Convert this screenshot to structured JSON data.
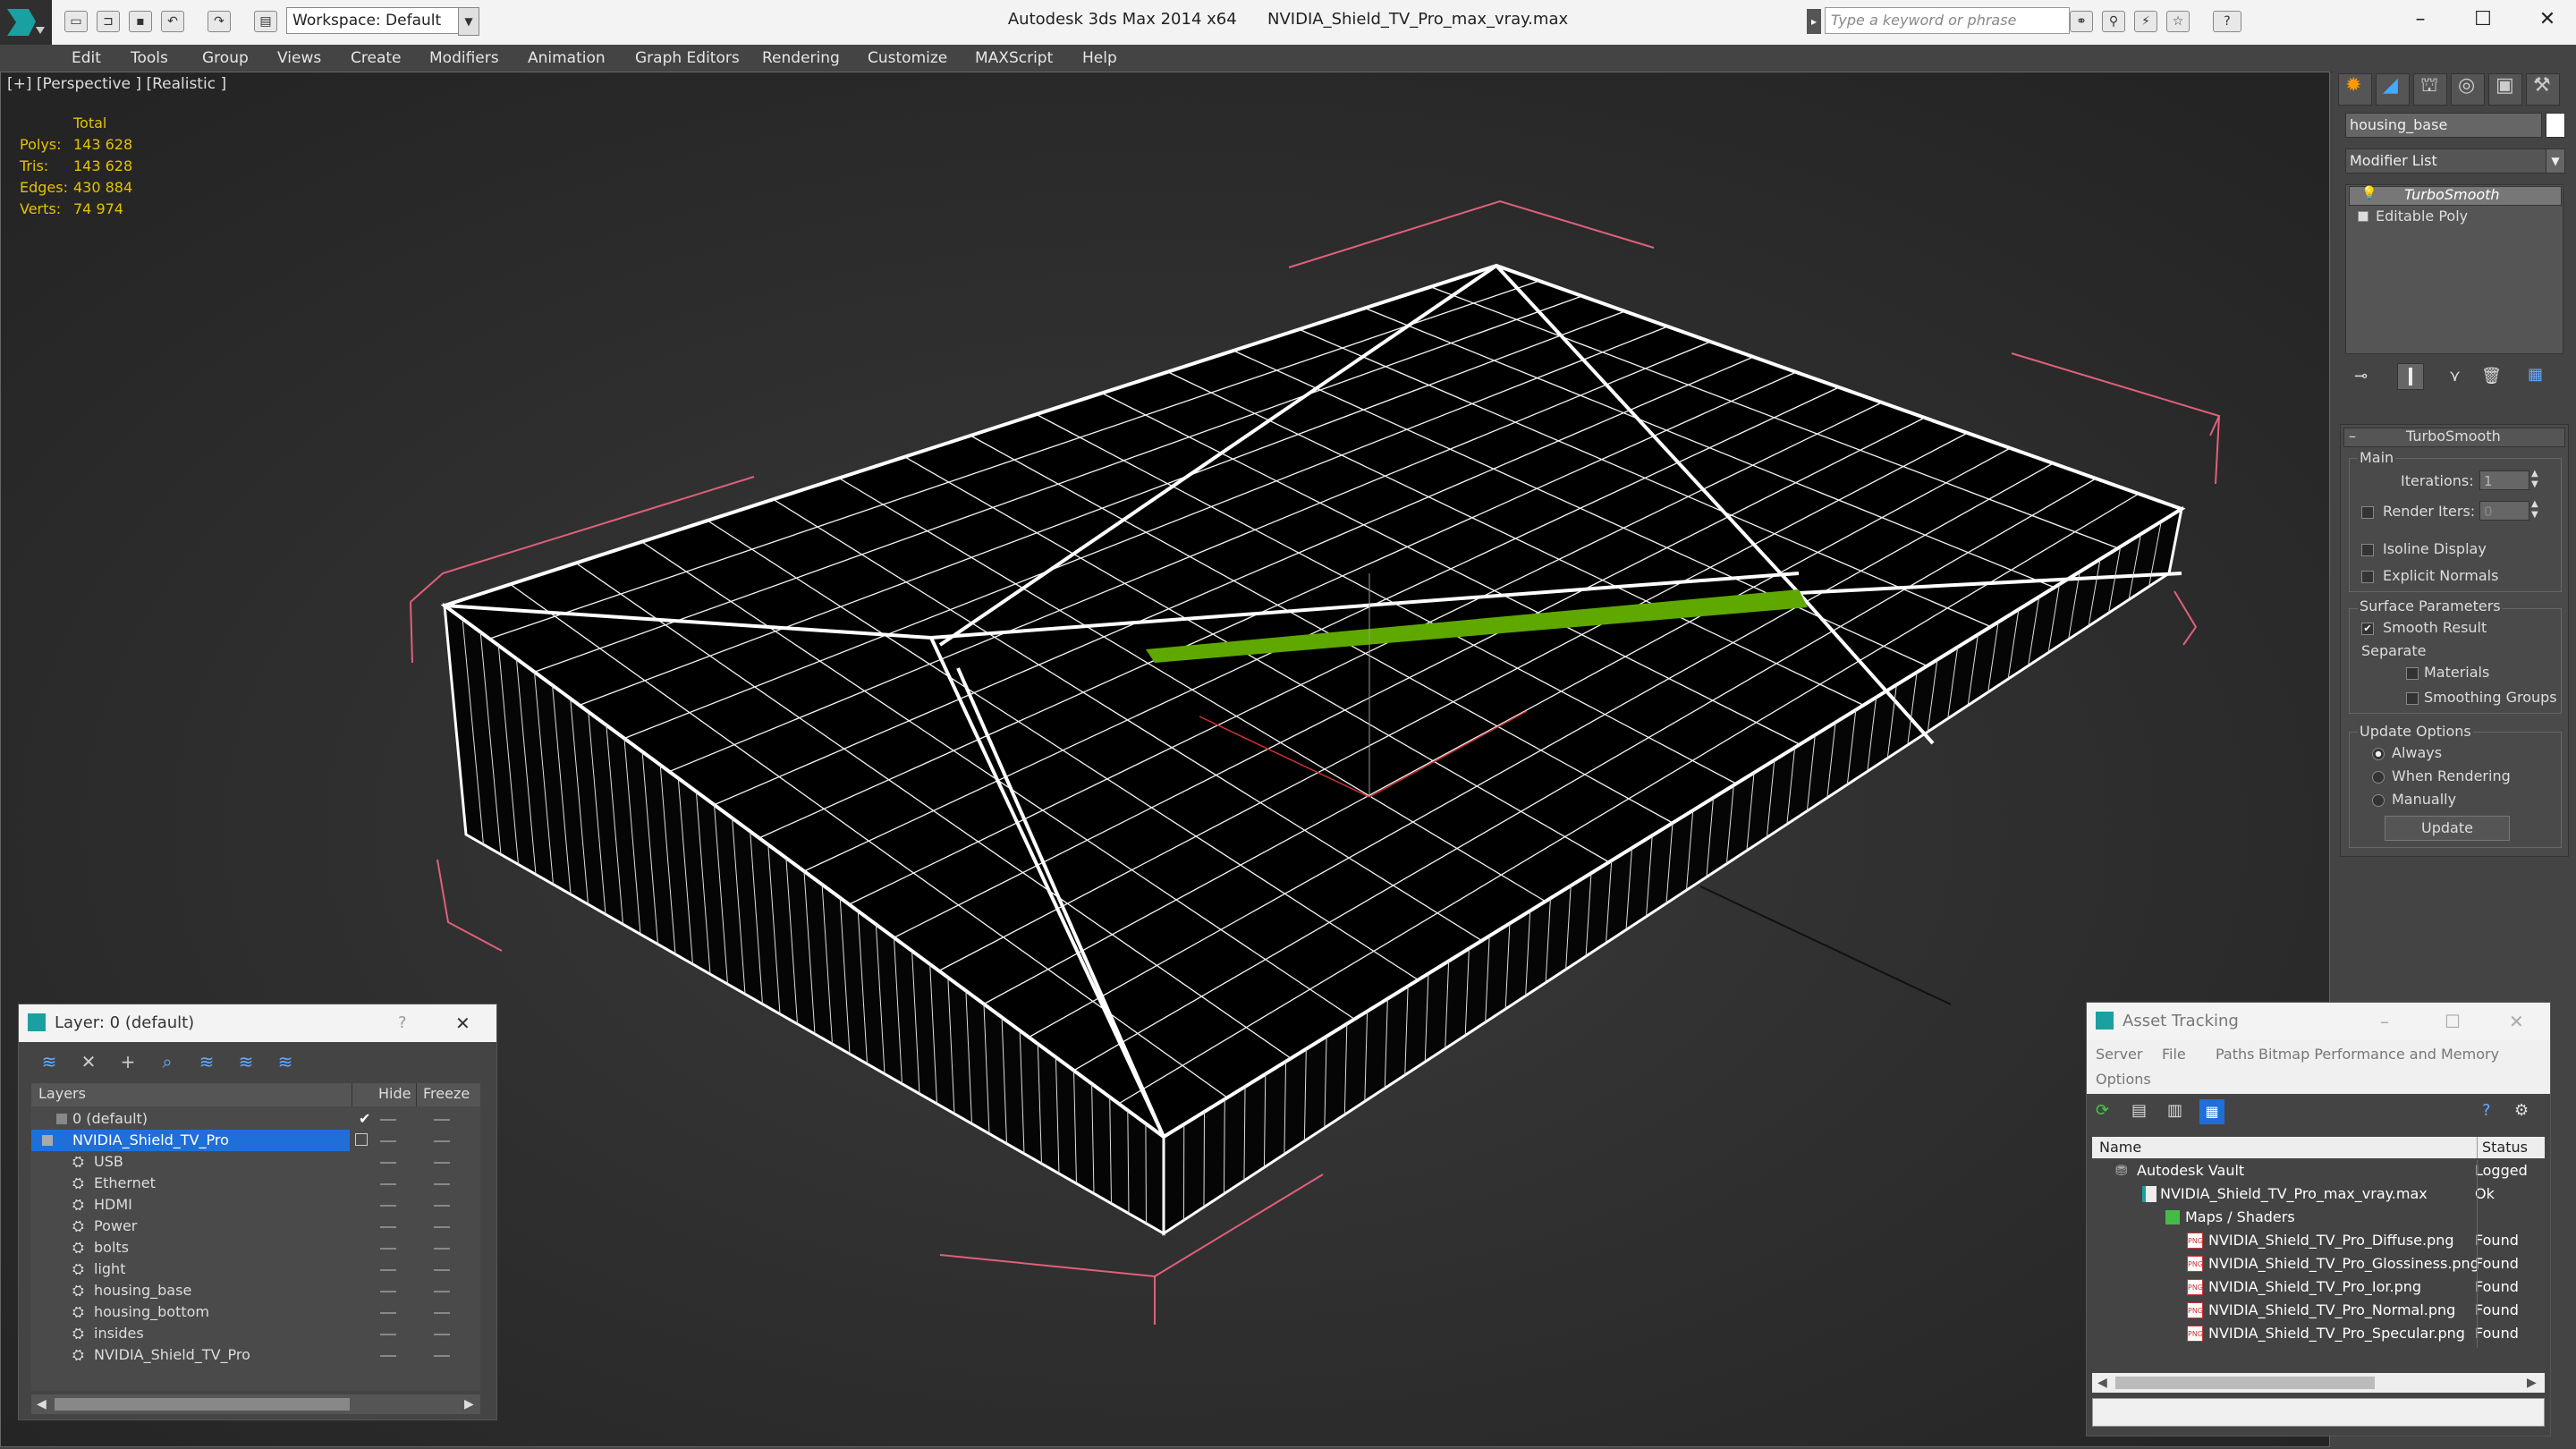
{
  "titlebar": {
    "app": "Autodesk 3ds Max  2014 x64",
    "file": "NVIDIA_Shield_TV_Pro_max_vray.max",
    "workspace": "Workspace: Default",
    "search_placeholder": "Type a keyword or phrase"
  },
  "menu": [
    "Edit",
    "Tools",
    "Group",
    "Views",
    "Create",
    "Modifiers",
    "Animation",
    "Graph Editors",
    "Rendering",
    "Customize",
    "MAXScript",
    "Help"
  ],
  "viewport": {
    "label": "[+] [Perspective ] [Realistic ]",
    "stats_header": "Total",
    "stats": [
      {
        "label": "Polys:",
        "value": "143 628"
      },
      {
        "label": "Tris:",
        "value": "143 628"
      },
      {
        "label": "Edges:",
        "value": "430 884"
      },
      {
        "label": "Verts:",
        "value": "74 974"
      }
    ]
  },
  "command_panel": {
    "object_name": "housing_base",
    "modifier_list": "Modifier List",
    "stack": [
      "TurboSmooth",
      "Editable Poly"
    ],
    "rollout_title": "TurboSmooth",
    "main_label": "Main",
    "iterations_label": "Iterations:",
    "iterations_value": "1",
    "render_iters_label": "Render Iters:",
    "render_iters_value": "0",
    "isoline_display": "Isoline Display",
    "explicit_normals": "Explicit Normals",
    "surface_parameters": "Surface Parameters",
    "smooth_result": "Smooth Result",
    "separate": "Separate",
    "materials": "Materials",
    "smoothing_groups": "Smoothing Groups",
    "update_options": "Update Options",
    "always": "Always",
    "when_rendering": "When Rendering",
    "manually": "Manually",
    "update_button": "Update"
  },
  "layer_window": {
    "title": "Layer: 0 (default)",
    "col_layers": "Layers",
    "col_hide": "Hide",
    "col_freeze": "Freeze",
    "rows": [
      "0 (default)",
      "NVIDIA_Shield_TV_Pro",
      "USB",
      "Ethernet",
      "HDMI",
      "Power",
      "bolts",
      "light",
      "housing_base",
      "housing_bottom",
      "insides",
      "NVIDIA_Shield_TV_Pro"
    ]
  },
  "asset_window": {
    "title": "Asset Tracking",
    "menu": [
      "Server",
      "File",
      "Paths",
      "Bitmap Performance and Memory",
      "Options"
    ],
    "col_name": "Name",
    "col_status": "Status",
    "rows": [
      {
        "name": "Autodesk Vault",
        "status": "Logged"
      },
      {
        "name": "NVIDIA_Shield_TV_Pro_max_vray.max",
        "status": "Ok"
      },
      {
        "name": "Maps / Shaders",
        "status": ""
      },
      {
        "name": "NVIDIA_Shield_TV_Pro_Diffuse.png",
        "status": "Found"
      },
      {
        "name": "NVIDIA_Shield_TV_Pro_Glossiness.png",
        "status": "Found"
      },
      {
        "name": "NVIDIA_Shield_TV_Pro_Ior.png",
        "status": "Found"
      },
      {
        "name": "NVIDIA_Shield_TV_Pro_Normal.png",
        "status": "Found"
      },
      {
        "name": "NVIDIA_Shield_TV_Pro_Specular.png",
        "status": "Found"
      }
    ],
    "png_tag": "PNG"
  },
  "colors": {
    "selection": "#1e6fd9",
    "stats_text": "#e5c200",
    "viewport_bg": "#2b2b2b",
    "green_strip": "#5fa800"
  }
}
